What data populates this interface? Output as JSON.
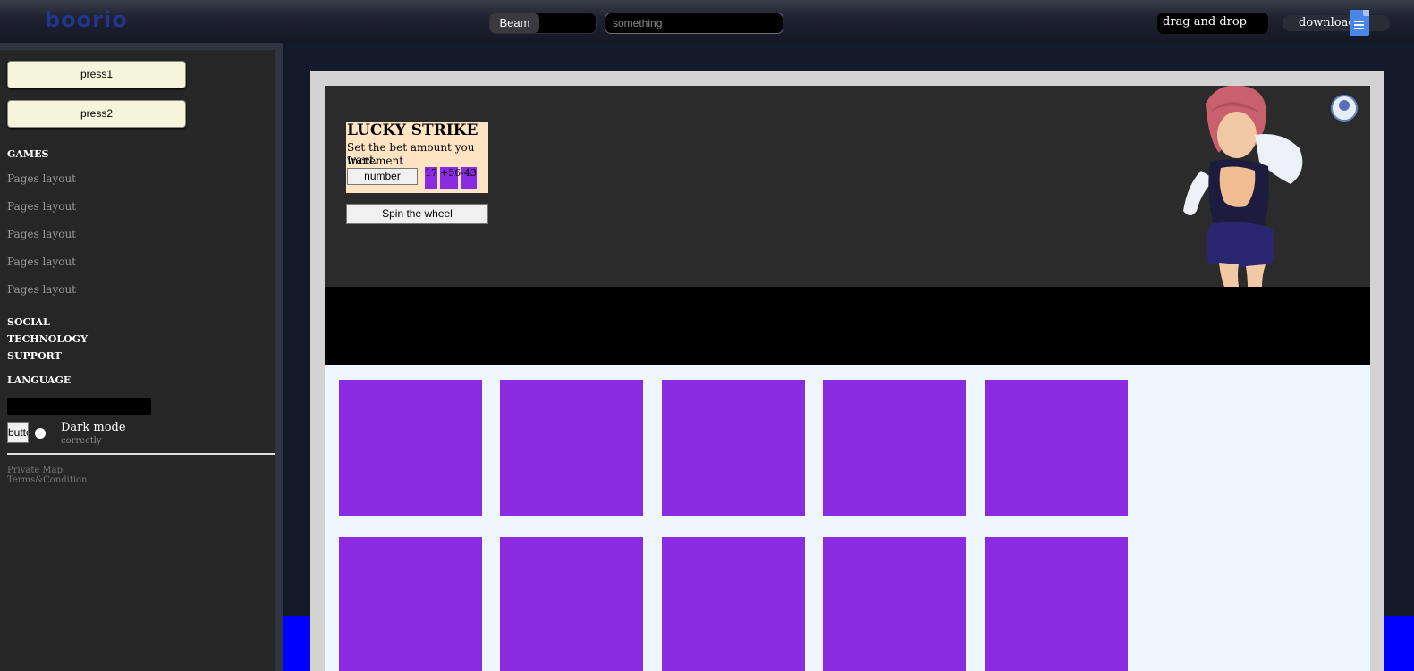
{
  "header": {
    "logo_text": "boorio",
    "segment_label": "Beam",
    "search_placeholder": "something",
    "dnd_label": "drag and drop",
    "download_label": "download"
  },
  "sidebar": {
    "buttons": [
      "press1",
      "press2"
    ],
    "games_heading": "GAMES",
    "links": [
      "Pages layout",
      "Pages layout",
      "Pages layout",
      "Pages layout",
      "Pages layout"
    ],
    "sections": [
      "SOCIAL",
      "TECHNOLOGY",
      "SUPPORT"
    ],
    "language_heading": "LANGUAGE",
    "dark_mode": {
      "button_label": "button",
      "label": "Dark mode",
      "sub": "correctly"
    },
    "footer_links": [
      "Private Map",
      "Terms&Condition"
    ]
  },
  "game": {
    "title": "LUCKY STRIKE",
    "description": "Set the bet amount you want.",
    "increment_label": "Increment",
    "input_placeholder": "number",
    "increments": [
      "17",
      "+56",
      "-43"
    ],
    "spin_label": "Spin the wheel"
  },
  "colors": {
    "accent": "#8a2be2",
    "hero_bg": "#2b2b2b",
    "card_bg": "#ffe4c4",
    "grid_bg": "#eef7fe"
  },
  "tiles_count": 10
}
